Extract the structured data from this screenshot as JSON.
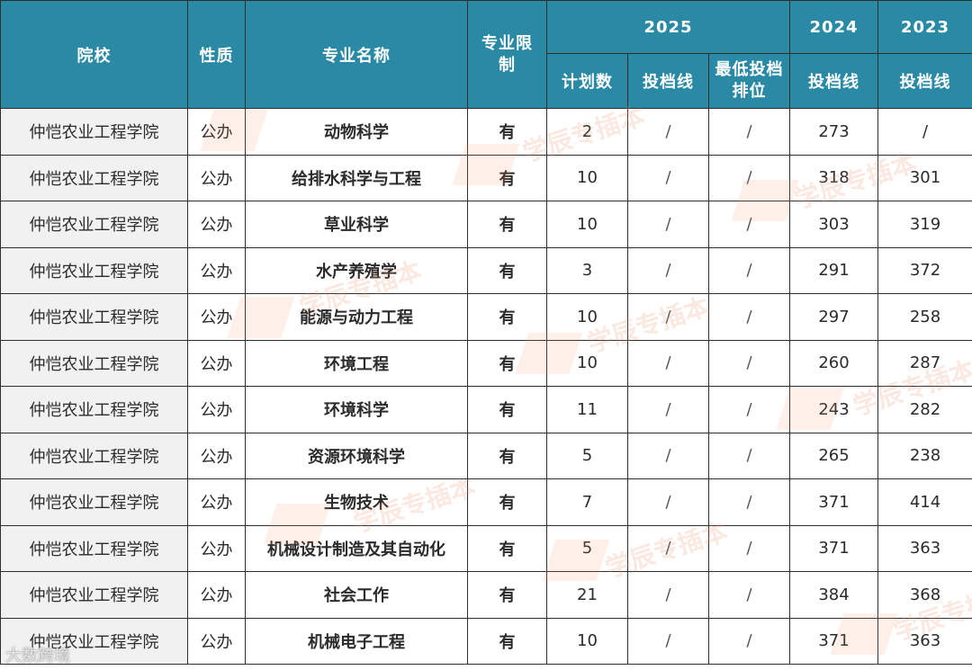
{
  "header": {
    "school": "院校",
    "nature": "性质",
    "major": "专业名称",
    "limit": "专业限制",
    "y2025": "2025",
    "y2024": "2024",
    "y2023": "2023",
    "plan": "计划数",
    "line2025": "投档线",
    "rank": "最低投档排位",
    "line2024": "投档线",
    "line2023": "投档线"
  },
  "rows": [
    {
      "school": "仲恺农业工程学院",
      "nature": "公办",
      "major": "动物科学",
      "limit": "有",
      "plan": "2",
      "line2025": "/",
      "rank": "/",
      "line2024": "273",
      "line2023": "/"
    },
    {
      "school": "仲恺农业工程学院",
      "nature": "公办",
      "major": "给排水科学与工程",
      "limit": "有",
      "plan": "10",
      "line2025": "/",
      "rank": "/",
      "line2024": "318",
      "line2023": "301"
    },
    {
      "school": "仲恺农业工程学院",
      "nature": "公办",
      "major": "草业科学",
      "limit": "有",
      "plan": "10",
      "line2025": "/",
      "rank": "/",
      "line2024": "303",
      "line2023": "319"
    },
    {
      "school": "仲恺农业工程学院",
      "nature": "公办",
      "major": "水产养殖学",
      "limit": "有",
      "plan": "3",
      "line2025": "/",
      "rank": "/",
      "line2024": "291",
      "line2023": "372"
    },
    {
      "school": "仲恺农业工程学院",
      "nature": "公办",
      "major": "能源与动力工程",
      "limit": "有",
      "plan": "10",
      "line2025": "/",
      "rank": "/",
      "line2024": "297",
      "line2023": "258"
    },
    {
      "school": "仲恺农业工程学院",
      "nature": "公办",
      "major": "环境工程",
      "limit": "有",
      "plan": "10",
      "line2025": "/",
      "rank": "/",
      "line2024": "260",
      "line2023": "287"
    },
    {
      "school": "仲恺农业工程学院",
      "nature": "公办",
      "major": "环境科学",
      "limit": "有",
      "plan": "11",
      "line2025": "/",
      "rank": "/",
      "line2024": "243",
      "line2023": "282"
    },
    {
      "school": "仲恺农业工程学院",
      "nature": "公办",
      "major": "资源环境科学",
      "limit": "有",
      "plan": "5",
      "line2025": "/",
      "rank": "/",
      "line2024": "265",
      "line2023": "238"
    },
    {
      "school": "仲恺农业工程学院",
      "nature": "公办",
      "major": "生物技术",
      "limit": "有",
      "plan": "7",
      "line2025": "/",
      "rank": "/",
      "line2024": "371",
      "line2023": "414"
    },
    {
      "school": "仲恺农业工程学院",
      "nature": "公办",
      "major": "机械设计制造及其自动化",
      "limit": "有",
      "plan": "5",
      "line2025": "/",
      "rank": "/",
      "line2024": "371",
      "line2023": "363"
    },
    {
      "school": "仲恺农业工程学院",
      "nature": "公办",
      "major": "社会工作",
      "limit": "有",
      "plan": "21",
      "line2025": "/",
      "rank": "/",
      "line2024": "384",
      "line2023": "368"
    },
    {
      "school": "仲恺农业工程学院",
      "nature": "公办",
      "major": "机械电子工程",
      "limit": "有",
      "plan": "10",
      "line2025": "/",
      "rank": "/",
      "line2024": "371",
      "line2023": "363"
    }
  ],
  "watermark": {
    "text": "学辰专插本",
    "sub": "XUECHEN ZHUANCHABEN"
  },
  "source_label": "大数跨境",
  "colors": {
    "header_bg": "#2a8aa6",
    "header_text": "#ffffff",
    "school_cell_bg": "#f1f1f1",
    "border": "#2e2e2e"
  }
}
